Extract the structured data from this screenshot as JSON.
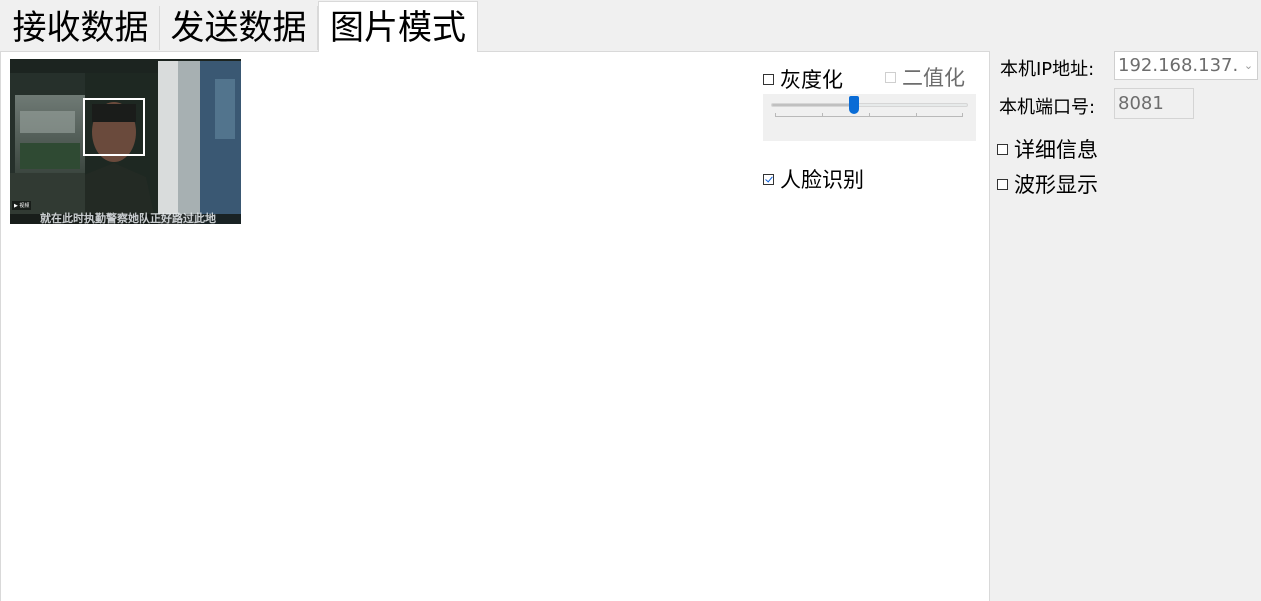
{
  "tabs": [
    {
      "label": "接收数据",
      "active": false
    },
    {
      "label": "发送数据",
      "active": false
    },
    {
      "label": "图片模式",
      "active": true
    }
  ],
  "image_mode": {
    "camera_subtitle": "就在此时执勤警察她队正好路过此地",
    "grayscale": {
      "label": "灰度化",
      "checked": false
    },
    "binarize": {
      "label": "二值化",
      "checked": false,
      "enabled": false
    },
    "threshold_slider": {
      "value": 0.42
    },
    "face_recognition": {
      "label": "人脸识别",
      "checked": true
    }
  },
  "network": {
    "ip_label": "本机IP地址:",
    "ip_value": "192.168.137.",
    "port_label": "本机端口号:",
    "port_value": "8081"
  },
  "options": {
    "detail_info": {
      "label": "详细信息",
      "checked": false
    },
    "waveform": {
      "label": "波形显示",
      "checked": false
    }
  },
  "colors": {
    "accent": "#0a6cd6",
    "face_box": "#ffffff",
    "pane_bg": "#ffffff",
    "window_bg": "#f0f0f0"
  }
}
